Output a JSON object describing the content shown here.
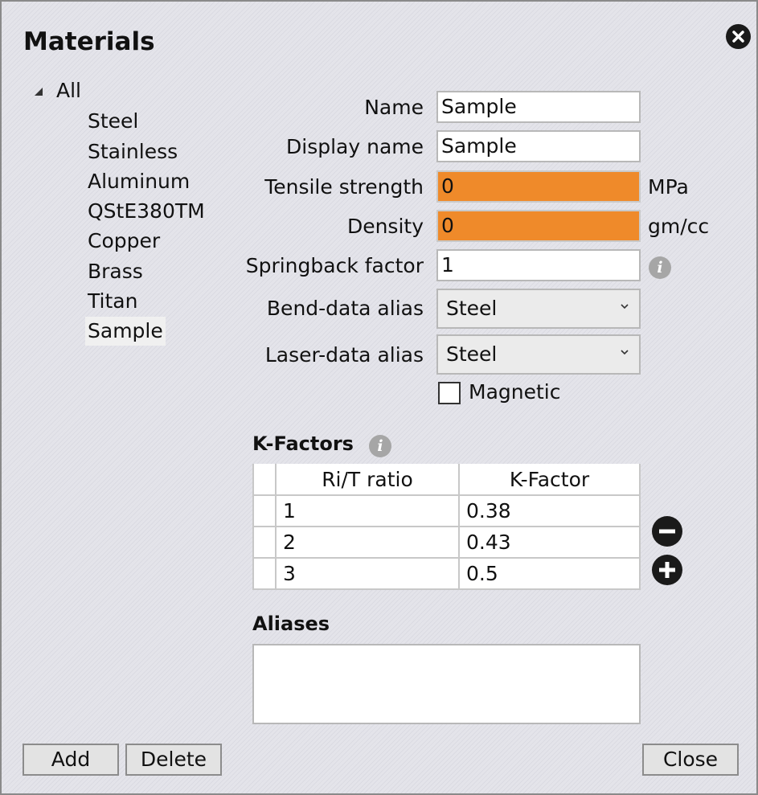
{
  "dialog": {
    "title": "Materials"
  },
  "tree": {
    "root_label": "All",
    "items": [
      "Steel",
      "Stainless",
      "Aluminum",
      "QStE380TM",
      "Copper",
      "Brass",
      "Titan",
      "Sample"
    ],
    "selected": "Sample"
  },
  "form": {
    "name_label": "Name",
    "name_value": "Sample",
    "display_name_label": "Display name",
    "display_name_value": "Sample",
    "tensile_label": "Tensile strength",
    "tensile_value": "0",
    "tensile_unit": "MPa",
    "density_label": "Density",
    "density_value": "0",
    "density_unit": "gm/cc",
    "springback_label": "Springback factor",
    "springback_value": "1",
    "bend_alias_label": "Bend-data alias",
    "bend_alias_value": "Steel",
    "laser_alias_label": "Laser-data alias",
    "laser_alias_value": "Steel",
    "magnetic_label": "Magnetic",
    "magnetic_checked": false,
    "error_color": "#ef8a2a"
  },
  "kfactors": {
    "title": "K-Factors",
    "columns": [
      "Ri/T ratio",
      "K-Factor"
    ],
    "rows": [
      [
        "1",
        "0.38"
      ],
      [
        "2",
        "0.43"
      ],
      [
        "3",
        "0.5"
      ]
    ]
  },
  "aliases": {
    "title": "Aliases",
    "value": ""
  },
  "buttons": {
    "add": "Add",
    "delete": "Delete",
    "close": "Close"
  },
  "icons": {
    "close": "close-icon",
    "info": "info-icon",
    "remove": "minus-circle-icon",
    "add": "plus-circle-icon",
    "expand": "expand-triangle-icon",
    "dropdown": "chevron-down-icon"
  }
}
